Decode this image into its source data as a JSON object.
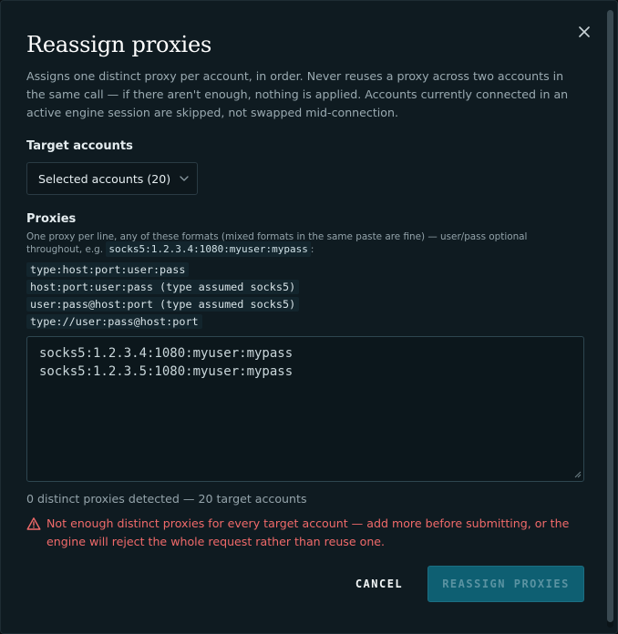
{
  "dialog": {
    "title": "Reassign proxies",
    "description": "Assigns one distinct proxy per account, in order. Never reuses a proxy across two accounts in the same call — if there aren't enough, nothing is applied. Accounts currently connected in an active engine session are skipped, not swapped mid-connection.",
    "close_icon": "close-icon"
  },
  "target_accounts": {
    "label": "Target accounts",
    "selected": "Selected accounts (20)"
  },
  "proxies": {
    "label": "Proxies",
    "hint_prefix": "One proxy per line, any of these formats (mixed formats in the same paste are fine) — user/pass optional throughout, e.g.",
    "hint_example": "socks5:1.2.3.4:1080:myuser:mypass",
    "hint_suffix": ":",
    "formats": [
      "type:host:port:user:pass",
      "host:port:user:pass (type assumed socks5)",
      "user:pass@host:port (type assumed socks5)",
      "type://user:pass@host:port"
    ],
    "value": "socks5:1.2.3.4:1080:myuser:mypass\nsocks5:1.2.3.5:1080:myuser:mypass"
  },
  "status": {
    "count_text": "0 distinct proxies detected — 20 target accounts",
    "warning": "Not enough distinct proxies for every target account — add more before submitting, or the engine will reject the whole request rather than reuse one."
  },
  "actions": {
    "cancel": "CANCEL",
    "submit": "REASSIGN PROXIES"
  },
  "colors": {
    "background": "#0f1b21",
    "accent": "#0e5f72",
    "error": "#f06a6a"
  }
}
